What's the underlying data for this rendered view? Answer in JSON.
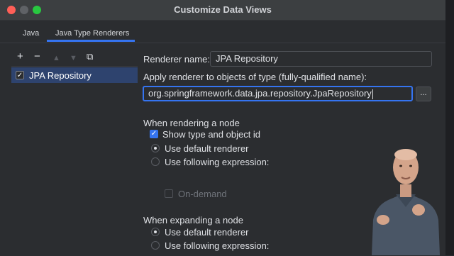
{
  "window": {
    "title": "Customize Data Views",
    "traffic_lights": [
      "close",
      "minimize",
      "maximize"
    ]
  },
  "tabs": [
    {
      "label": "Java",
      "selected": false
    },
    {
      "label": "Java Type Renderers",
      "selected": true
    }
  ],
  "toolbar": {
    "add_icon": "+",
    "remove_icon": "−",
    "up_icon": "▲",
    "down_icon": "▼",
    "copy_icon": "⧉"
  },
  "renderers_list": {
    "items": [
      {
        "label": "JPA Repository",
        "checked": true,
        "selected": true
      }
    ]
  },
  "form": {
    "renderer_name_label": "Renderer name:",
    "renderer_name_value": "JPA Repository",
    "apply_type_label": "Apply renderer to objects of type (fully-qualified name):",
    "apply_type_value": "org.springframework.data.jpa.repository.JpaRepository",
    "browse_label": "...",
    "when_rendering_title": "When rendering a node",
    "show_type_label": "Show type and object id",
    "show_type_checked": true,
    "rendering_default_label": "Use default renderer",
    "rendering_expression_label": "Use following expression:",
    "rendering_selected": "default",
    "on_demand_label": "On-demand",
    "on_demand_checked": false,
    "when_expanding_title": "When expanding a node",
    "expanding_default_label": "Use default renderer",
    "expanding_expression_label": "Use following expression:",
    "expanding_selected": "default"
  },
  "colors": {
    "background": "#2b2d30",
    "accent": "#3574f0",
    "selection": "#2e436e",
    "text": "#dfe1e5"
  }
}
